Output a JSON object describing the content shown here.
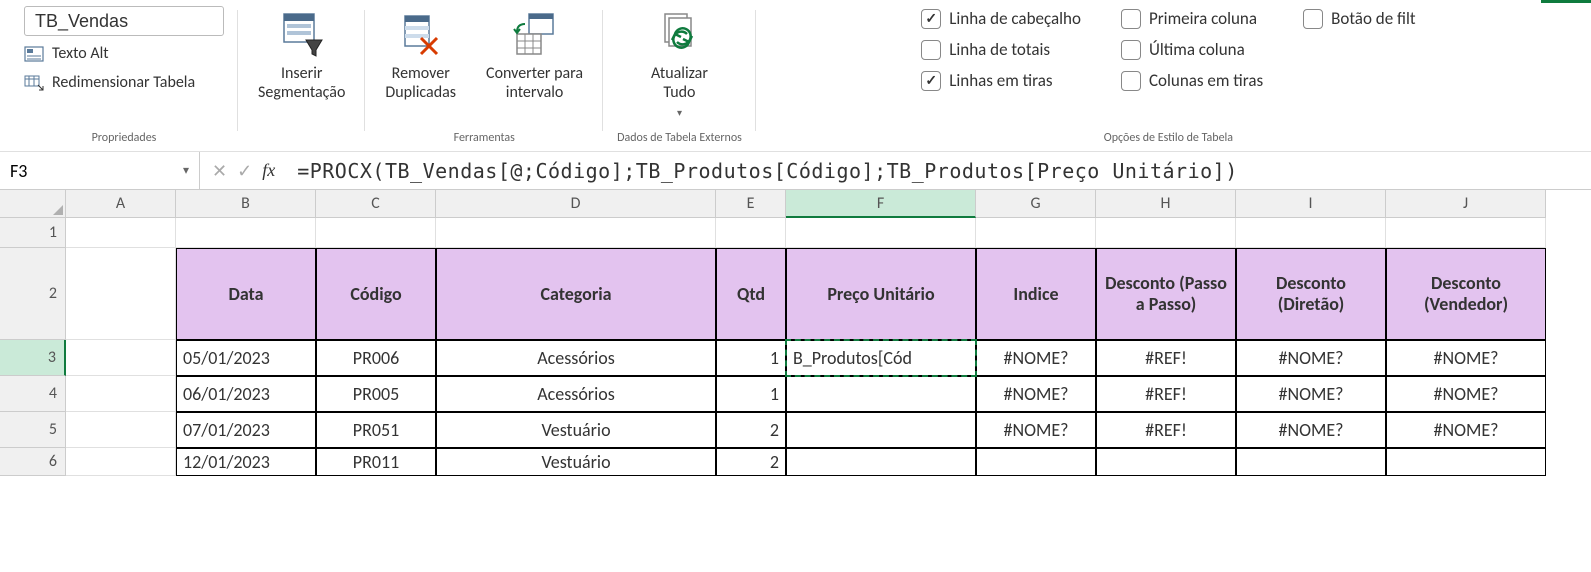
{
  "ribbon": {
    "properties": {
      "table_name": "TB_Vendas",
      "alt_text": "Texto Alt",
      "resize": "Redimensionar Tabela",
      "group_label": "Propriedades"
    },
    "insert_slicer": "Inserir\nSegmentação",
    "tools": {
      "remove_dup": "Remover\nDuplicadas",
      "convert": "Converter para\nintervalo",
      "group_label": "Ferramentas"
    },
    "external": {
      "refresh": "Atualizar\nTudo",
      "group_label": "Dados de Tabela Externos"
    },
    "style_options": {
      "header_row": "Linha de cabeçalho",
      "total_row": "Linha de totais",
      "banded_rows": "Linhas em tiras",
      "first_col": "Primeira coluna",
      "last_col": "Última coluna",
      "banded_cols": "Colunas em tiras",
      "filter_btn": "Botão de filt",
      "group_label": "Opções de Estilo de Tabela"
    }
  },
  "formula_bar": {
    "namebox": "F3",
    "formula": "=PROCX(TB_Vendas[@;Código];TB_Produtos[Código];TB_Produtos[Preço Unitário])"
  },
  "columns": [
    "A",
    "B",
    "C",
    "D",
    "E",
    "F",
    "G",
    "H",
    "I",
    "J"
  ],
  "active_column": "F",
  "active_row": "3",
  "rows_visible": [
    "1",
    "2",
    "3",
    "4",
    "5",
    "6"
  ],
  "table": {
    "headers": {
      "B": "Data",
      "C": "Código",
      "D": "Categoria",
      "E": "Qtd",
      "F": "Preço Unitário",
      "G": "Indice",
      "H": "Desconto (Passo a Passo)",
      "I": "Desconto (Diretão)",
      "J": "Desconto (Vendedor)"
    },
    "rows": [
      {
        "B": "05/01/2023",
        "C": "PR006",
        "D": "Acessórios",
        "E": "1",
        "F": "B_Produtos[Cód",
        "G": "#NOME?",
        "H": "#REF!",
        "I": "#NOME?",
        "J": "#NOME?"
      },
      {
        "B": "06/01/2023",
        "C": "PR005",
        "D": "Acessórios",
        "E": "1",
        "F": "",
        "G": "#NOME?",
        "H": "#REF!",
        "I": "#NOME?",
        "J": "#NOME?"
      },
      {
        "B": "07/01/2023",
        "C": "PR051",
        "D": "Vestuário",
        "E": "2",
        "F": "",
        "G": "#NOME?",
        "H": "#REF!",
        "I": "#NOME?",
        "J": "#NOME?"
      },
      {
        "B": "12/01/2023",
        "C": "PR011",
        "D": "Vestuário",
        "E": "2",
        "F": "",
        "G": "",
        "H": "",
        "I": "",
        "J": ""
      }
    ]
  }
}
